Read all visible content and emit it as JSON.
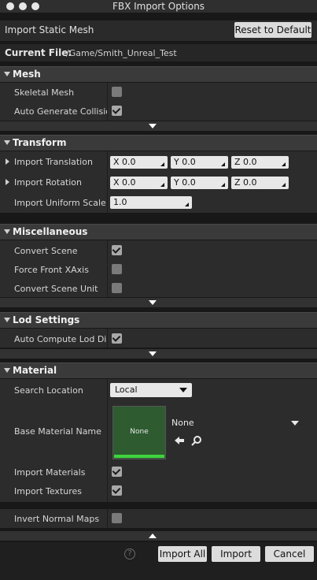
{
  "window": {
    "title": "FBX Import Options"
  },
  "header": {
    "import_type": "Import Static Mesh",
    "reset_label": "Reset to Default"
  },
  "current_file": {
    "label": "Current File:",
    "value": "/Game/Smith_Unreal_Test"
  },
  "mesh": {
    "title": "Mesh",
    "rows": [
      {
        "label": "Skeletal Mesh",
        "checked": false
      },
      {
        "label": "Auto Generate Collision",
        "checked": true
      }
    ]
  },
  "transform": {
    "title": "Transform",
    "translation": {
      "label": "Import Translation",
      "x": "X  0.0",
      "y": "Y  0.0",
      "z": "Z  0.0"
    },
    "rotation": {
      "label": "Import Rotation",
      "x": "X  0.0",
      "y": "Y  0.0",
      "z": "Z  0.0"
    },
    "scale": {
      "label": "Import Uniform Scale",
      "value": "1.0"
    }
  },
  "misc": {
    "title": "Miscellaneous",
    "rows": [
      {
        "label": "Convert Scene",
        "checked": true
      },
      {
        "label": "Force Front XAxis",
        "checked": false
      },
      {
        "label": "Convert Scene Unit",
        "checked": false
      }
    ]
  },
  "lod": {
    "title": "Lod Settings",
    "rows": [
      {
        "label": "Auto Compute Lod Distances",
        "checked": true
      }
    ]
  },
  "material": {
    "title": "Material",
    "search_location": {
      "label": "Search Location",
      "value": "Local"
    },
    "base_material": {
      "label": "Base Material Name",
      "thumb_text": "None",
      "asset_value": "None"
    },
    "rows": [
      {
        "label": "Import Materials",
        "checked": true
      },
      {
        "label": "Import Textures",
        "checked": true
      },
      {
        "label": "Invert Normal Maps",
        "checked": false
      }
    ]
  },
  "footer": {
    "help": "?",
    "import_all": "Import All",
    "import": "Import",
    "cancel": "Cancel"
  }
}
